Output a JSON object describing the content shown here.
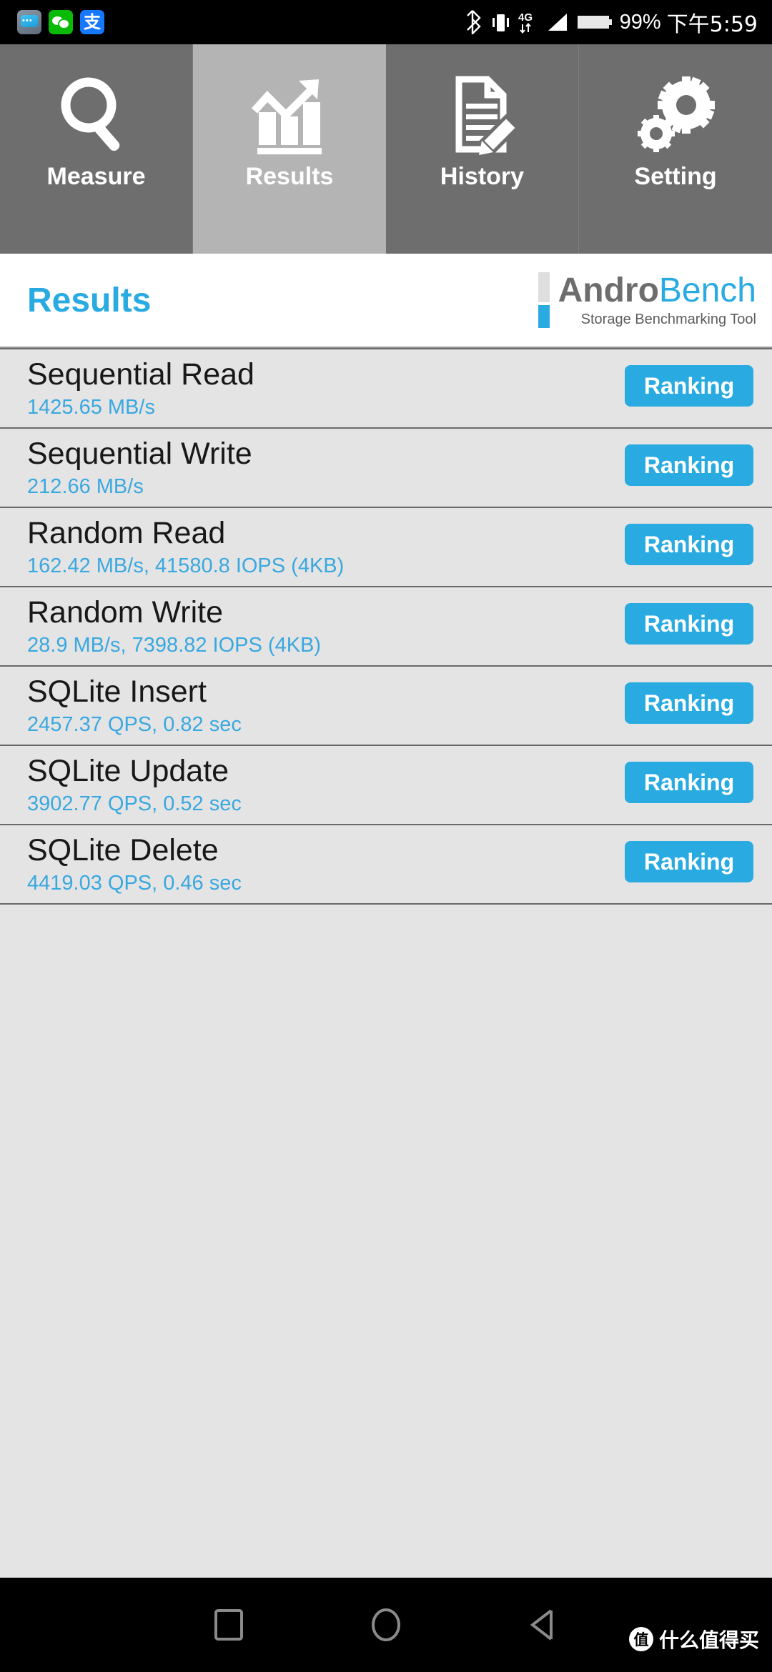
{
  "status_bar": {
    "app_icons": [
      {
        "name": "message-app-icon",
        "glyph": "•••"
      },
      {
        "name": "wechat-app-icon",
        "glyph": ""
      },
      {
        "name": "alipay-app-icon",
        "glyph": "支"
      }
    ],
    "bluetooth": "bluetooth-icon",
    "vibrate": "vibrate-icon",
    "network_type": "4G",
    "signal": "signal-icon",
    "battery": "battery-icon",
    "battery_percent": "99%",
    "time": "下午5:59"
  },
  "tabs": [
    {
      "label": "Measure",
      "icon": "magnifier-icon",
      "active": false
    },
    {
      "label": "Results",
      "icon": "bar-chart-trend-icon",
      "active": true
    },
    {
      "label": "History",
      "icon": "document-pencil-icon",
      "active": false
    },
    {
      "label": "Setting",
      "icon": "gears-icon",
      "active": false
    }
  ],
  "header": {
    "title": "Results",
    "logo_primary": "Andro",
    "logo_secondary": "Bench",
    "logo_subtitle": "Storage Benchmarking Tool"
  },
  "colors": {
    "accent_blue": "#29ABE2",
    "value_blue": "#3aa8e0",
    "tab_inactive": "#6e6e6e",
    "tab_active": "#b4b4b4",
    "list_bg": "#e4e4e4"
  },
  "results": [
    {
      "title": "Sequential Read",
      "value": "1425.65 MB/s",
      "button": "Ranking"
    },
    {
      "title": "Sequential Write",
      "value": "212.66 MB/s",
      "button": "Ranking"
    },
    {
      "title": "Random Read",
      "value": "162.42 MB/s, 41580.8 IOPS (4KB)",
      "button": "Ranking"
    },
    {
      "title": "Random Write",
      "value": "28.9 MB/s, 7398.82 IOPS (4KB)",
      "button": "Ranking"
    },
    {
      "title": "SQLite Insert",
      "value": "2457.37 QPS, 0.82 sec",
      "button": "Ranking"
    },
    {
      "title": "SQLite Update",
      "value": "3902.77 QPS, 0.52 sec",
      "button": "Ranking"
    },
    {
      "title": "SQLite Delete",
      "value": "4419.03 QPS, 0.46 sec",
      "button": "Ranking"
    }
  ],
  "nav_bar": {
    "recents": "square-recents-icon",
    "home": "circle-home-icon",
    "back": "triangle-back-icon"
  },
  "watermark": {
    "logo": "值",
    "text": "什么值得买"
  }
}
